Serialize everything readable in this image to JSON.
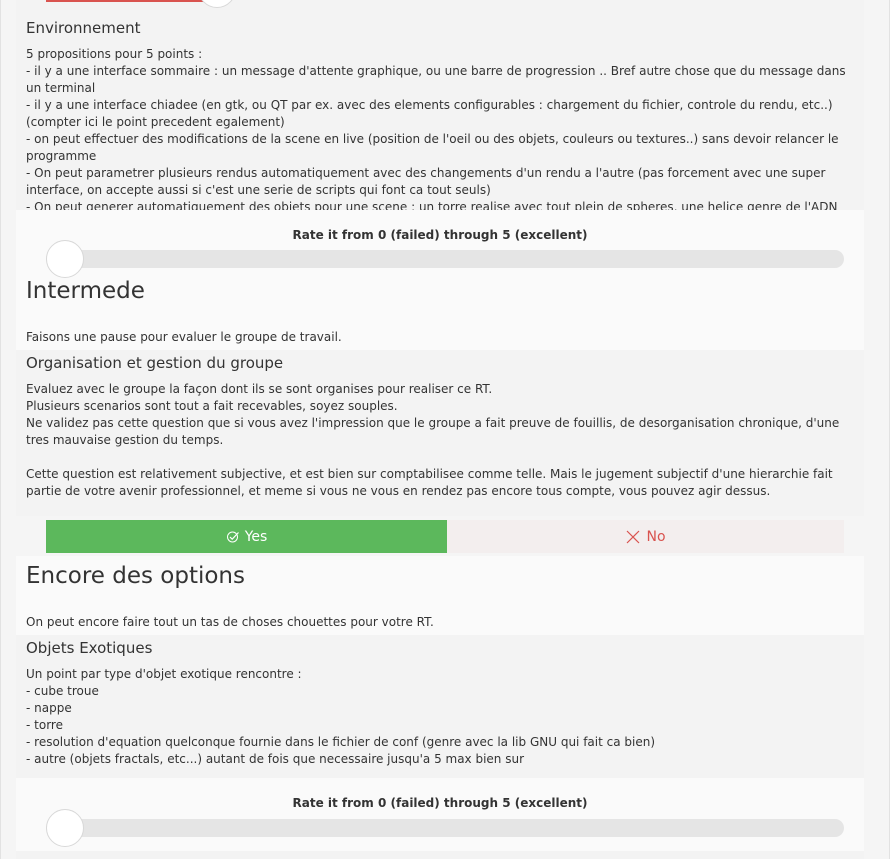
{
  "environnement": {
    "title": "Environnement",
    "lines": [
      "5 propositions pour 5 points :",
      "- il y a une interface sommaire : un message d'attente graphique, ou une barre de progression .. Bref autre chose que du message dans un terminal",
      "- il y a une interface chiadee (en gtk, ou QT par ex. avec des elements configurables : chargement du fichier, controle du rendu, etc..) (compter ici le point precedent egalement)",
      "- on peut effectuer des modifications de la scene en live (position de l'oeil ou des objets, couleurs ou textures..) sans devoir relancer le programme",
      "- On peut parametrer plusieurs rendus automatiquement avec des changements d'un rendu a l'autre (pas forcement avec une super interface, on accepte aussi si c'est une serie de scripts qui font ca tout seuls)",
      "- On peut generer automatiquement des objets pour une scene : un torre realise avec tout plein de spheres, une helice genre de l'ADN avec des spheres et des cylindres.."
    ],
    "rate_label": "Rate it from 0 (failed) through 5 (excellent)",
    "rating": 0
  },
  "intermede": {
    "title": "Intermede",
    "intro": "Faisons une pause pour evaluer le groupe de travail.",
    "subtitle": "Organisation et gestion du groupe",
    "lines": [
      "Evaluez avec le groupe la façon dont ils se sont organises pour realiser ce RT.",
      "Plusieurs scenarios sont tout a fait recevables, soyez souples.",
      "Ne validez pas cette question que si vous avez l'impression que le groupe a fait preuve de fouillis, de desorganisation chronique, d'une tres mauvaise gestion du temps.",
      "",
      "Cette question est relativement subjective, et est bien sur comptabilisee comme telle. Mais le jugement subjectif d'une hierarchie fait partie de votre avenir professionnel, et meme si vous ne vous en rendez pas encore tous compte, vous pouvez agir dessus."
    ],
    "yes_label": "Yes",
    "no_label": "No",
    "selected": "yes"
  },
  "options": {
    "title": "Encore des options",
    "intro": "On peut encore faire tout un tas de choses chouettes pour votre RT.",
    "subtitle": "Objets Exotiques",
    "lines": [
      "Un point par type d'objet exotique rencontre :",
      "- cube troue",
      "- nappe",
      "- torre",
      "- resolution d'equation quelconque fournie dans le fichier de conf (genre avec la lib GNU qui fait ca bien)",
      "- autre (objets fractals, etc...) autant de fois que necessaire jusqu'a 5 max bien sur"
    ],
    "rate_label": "Rate it from 0 (failed) through 5 (excellent)",
    "rating": 0
  },
  "colors": {
    "yes_bg": "#5cb85c",
    "no_text": "#d9534f",
    "track": "#e5e5e5"
  },
  "icons": {
    "yes": "check-circle-icon",
    "no": "close-icon"
  }
}
